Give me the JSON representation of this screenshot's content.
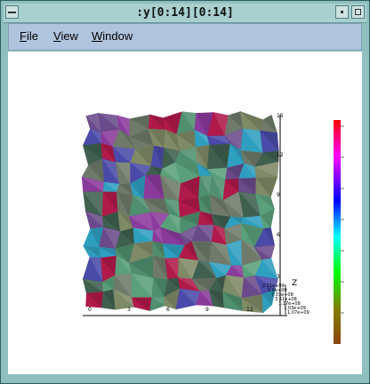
{
  "window": {
    "title": ":y[0:14][0:14]"
  },
  "menu": {
    "file": {
      "u": "F",
      "rest": "ile"
    },
    "view": {
      "u": "V",
      "rest": "iew"
    },
    "window": {
      "u": "W",
      "rest": "indow"
    }
  },
  "plot": {
    "x_ticks": [
      "0",
      "3",
      "6",
      "9",
      "12"
    ],
    "y_ticks": [
      "15",
      "12",
      "9",
      "6",
      "3"
    ],
    "z_label": "Z",
    "z_values": [
      "2.11e+09",
      "1.4e+09",
      "7.03e+08",
      "3.51e+08",
      "1.17e+08",
      "1.03e+09",
      "1.07e+09"
    ],
    "surface_colors": [
      "#6f7a6a",
      "#7f8a66",
      "#4f8f6f",
      "#2f9fbf",
      "#4a4aa8",
      "#8a3a9a",
      "#b01a4a",
      "#3f5f4f",
      "#6a4a8a",
      "#5aa07a"
    ]
  },
  "colorbar": {
    "colors": [
      "#ff0000",
      "#ff00ff",
      "#0000ff",
      "#00ffff",
      "#00ff00",
      "#808000",
      "#8b4513"
    ]
  }
}
